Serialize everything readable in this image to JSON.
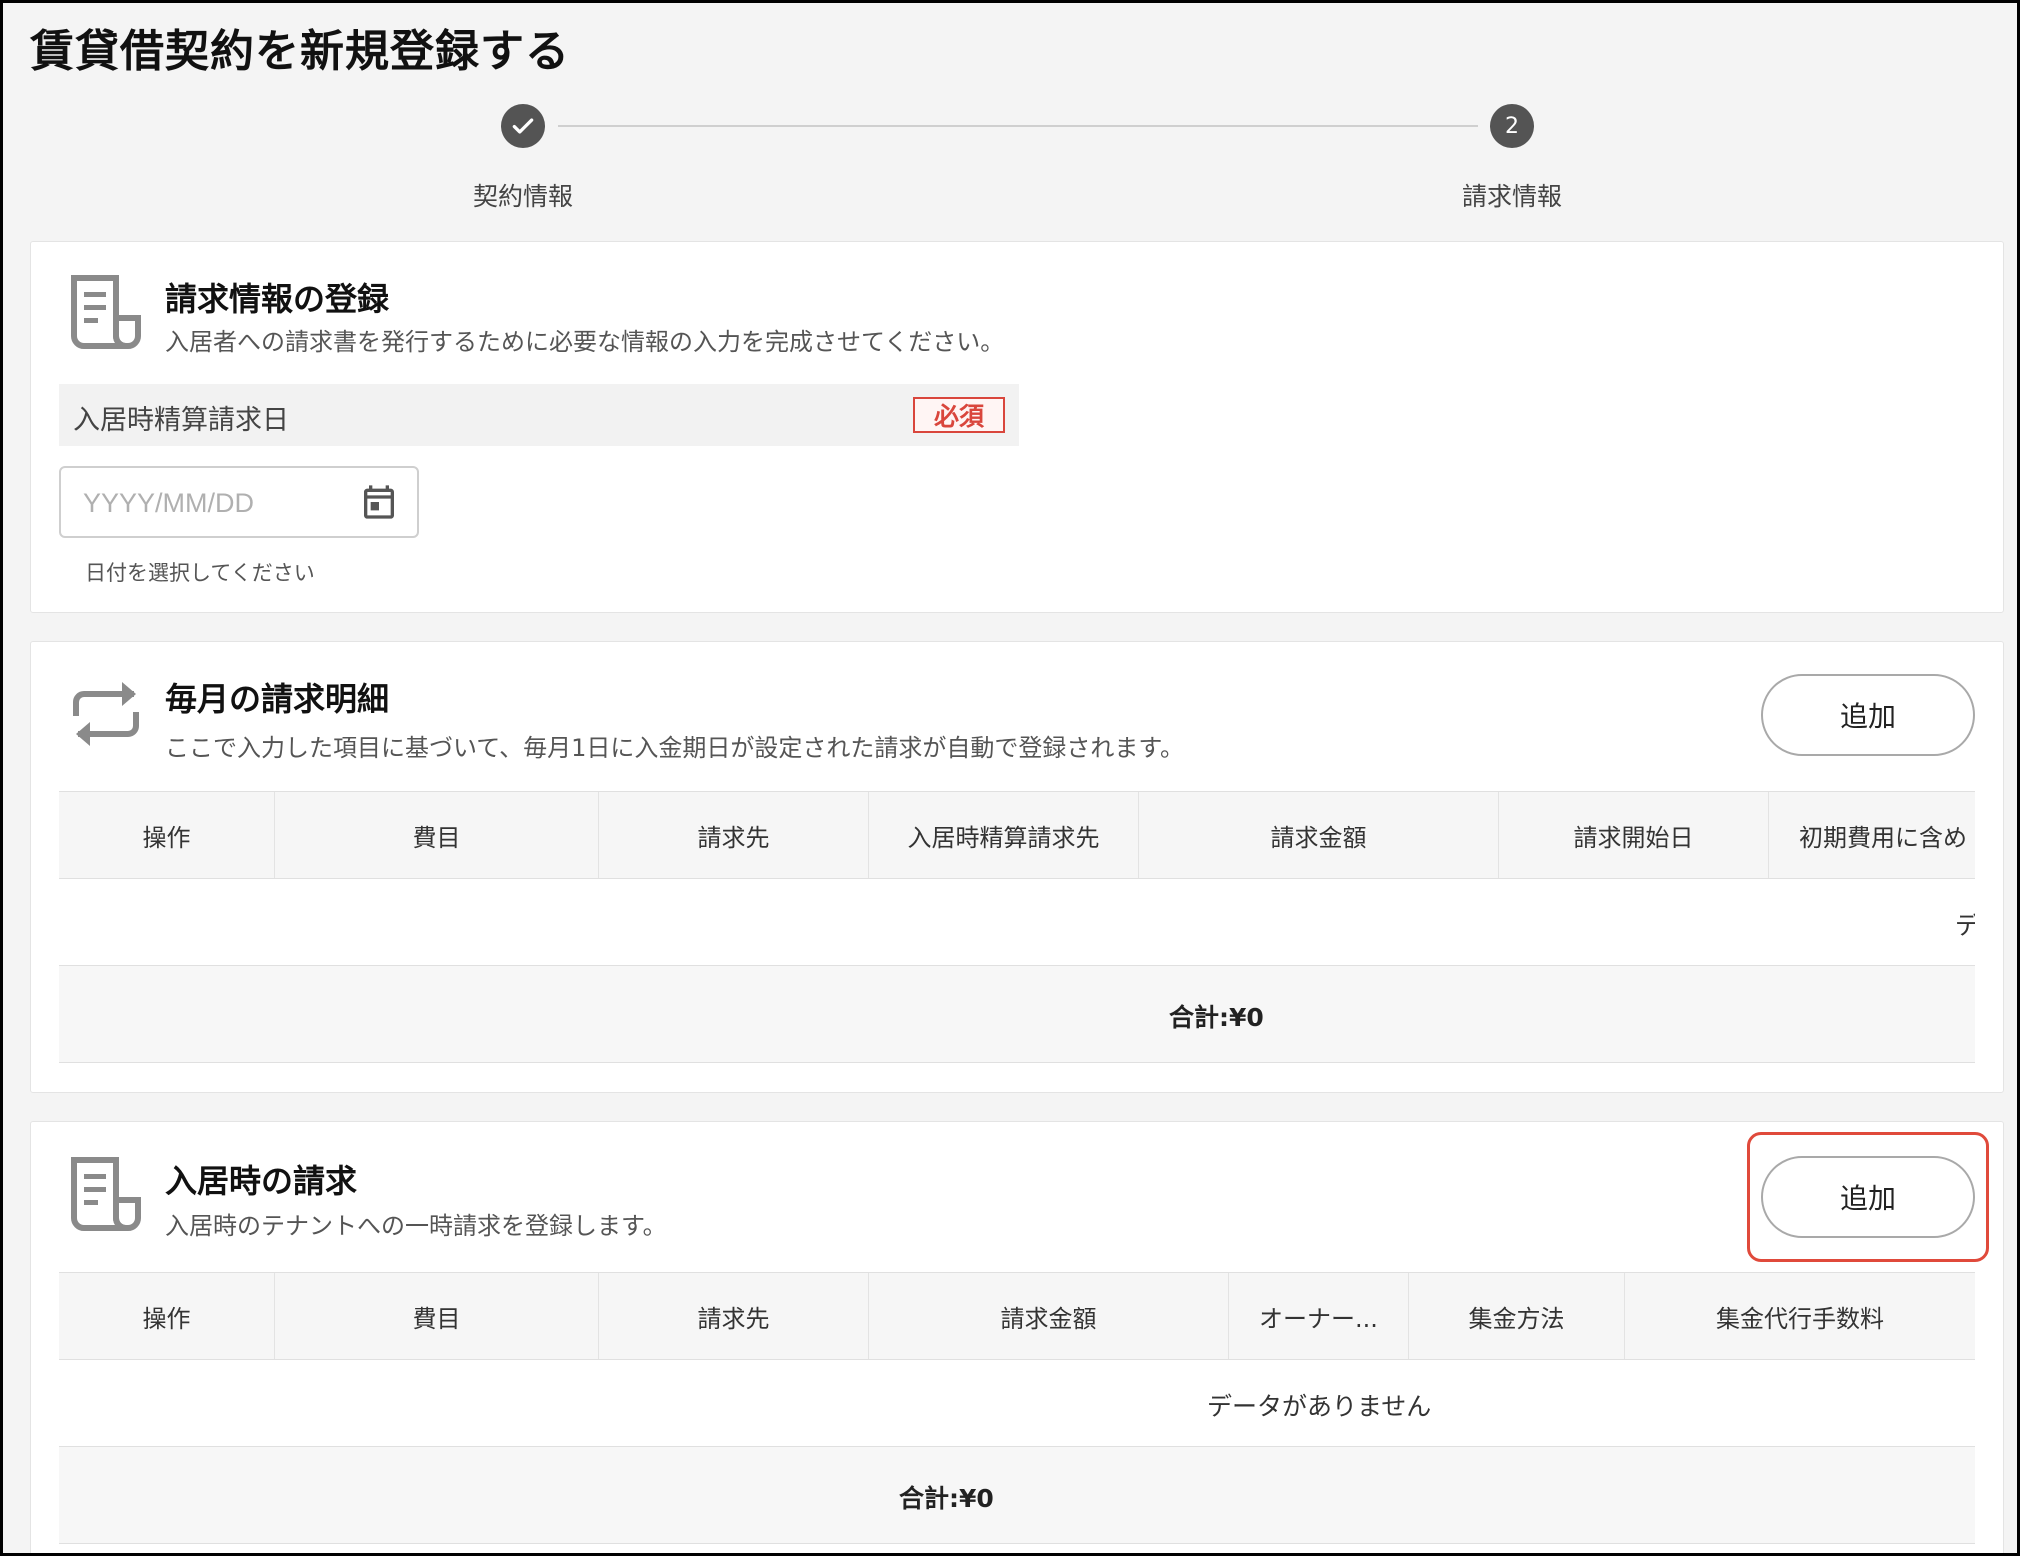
{
  "page": {
    "title": "賃貸借契約を新規登録する"
  },
  "stepper": {
    "steps": [
      {
        "label": "契約情報",
        "state": "done"
      },
      {
        "label": "請求情報",
        "number": "2",
        "state": "current"
      }
    ]
  },
  "billing_section": {
    "title": "請求情報の登録",
    "description": "入居者への請求書を発行するために必要な情報の入力を完成させてください。",
    "field": {
      "label": "入居時精算請求日",
      "required_badge": "必須",
      "placeholder": "YYYY/MM/DD",
      "help": "日付を選択してください"
    }
  },
  "monthly_section": {
    "title": "毎月の請求明細",
    "description": "ここで入力した項目に基づいて、毎月1日に入金期日が設定された請求が自動で登録されます。",
    "add_label": "追加",
    "columns": [
      "操作",
      "費目",
      "請求先",
      "入居時精算請求先",
      "請求金額",
      "請求開始日",
      "初期費用に含め"
    ],
    "empty_text_clipped": "デ",
    "total": "合計:¥0"
  },
  "movein_section": {
    "title": "入居時の請求",
    "description": "入居時のテナントへの一時請求を登録します。",
    "add_label": "追加",
    "columns": [
      "操作",
      "費目",
      "請求先",
      "請求金額",
      "オーナー...",
      "集金方法",
      "集金代行手数料"
    ],
    "empty_text": "データがありません",
    "total": "合計:¥0"
  },
  "colors": {
    "accent_highlight": "#e04a3b",
    "required": "#d9463c",
    "step": "#545454"
  }
}
